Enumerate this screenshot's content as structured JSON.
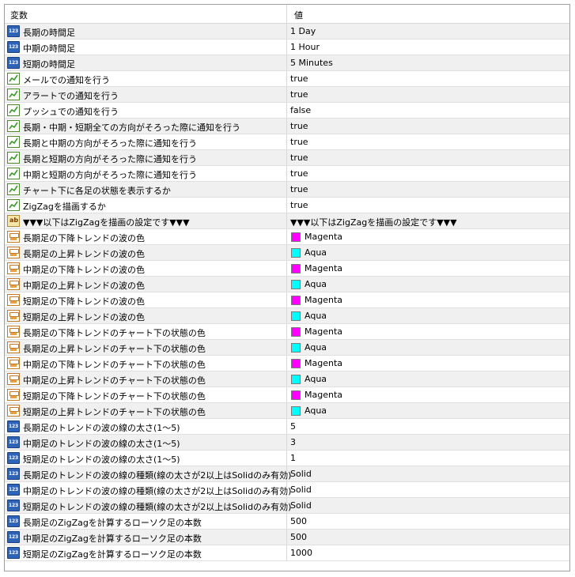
{
  "header": {
    "name_col": "変数",
    "value_col": "値"
  },
  "rows": [
    {
      "icon": "numeric-icon",
      "name": "長期の時間足",
      "value": "1 Day"
    },
    {
      "icon": "numeric-icon",
      "name": "中期の時間足",
      "value": "1 Hour"
    },
    {
      "icon": "numeric-icon",
      "name": "短期の時間足",
      "value": "5 Minutes"
    },
    {
      "icon": "boolean-icon",
      "name": "メールでの通知を行う",
      "value": "true"
    },
    {
      "icon": "boolean-icon",
      "name": "アラートでの通知を行う",
      "value": "true"
    },
    {
      "icon": "boolean-icon",
      "name": "プッシュでの通知を行う",
      "value": "false"
    },
    {
      "icon": "boolean-icon",
      "name": "長期・中期・短期全ての方向がそろった際に通知を行う",
      "value": "true"
    },
    {
      "icon": "boolean-icon",
      "name": "長期と中期の方向がそろった際に通知を行う",
      "value": "true"
    },
    {
      "icon": "boolean-icon",
      "name": "長期と短期の方向がそろった際に通知を行う",
      "value": "true"
    },
    {
      "icon": "boolean-icon",
      "name": "中期と短期の方向がそろった際に通知を行う",
      "value": "true"
    },
    {
      "icon": "boolean-icon",
      "name": "チャート下に各足の状態を表示するか",
      "value": "true"
    },
    {
      "icon": "boolean-icon",
      "name": "ZigZagを描画するか",
      "value": "true"
    },
    {
      "icon": "string-icon",
      "name": "▼▼▼以下はZigZagを描画の設定です▼▼▼",
      "value": "▼▼▼以下はZigZagを描画の設定です▼▼▼"
    },
    {
      "icon": "color-icon",
      "name": "長期足の下降トレンドの波の色",
      "value": "Magenta",
      "color": "#ff00ff"
    },
    {
      "icon": "color-icon",
      "name": "長期足の上昇トレンドの波の色",
      "value": "Aqua",
      "color": "#00ffff"
    },
    {
      "icon": "color-icon",
      "name": "中期足の下降トレンドの波の色",
      "value": "Magenta",
      "color": "#ff00ff"
    },
    {
      "icon": "color-icon",
      "name": "中期足の上昇トレンドの波の色",
      "value": "Aqua",
      "color": "#00ffff"
    },
    {
      "icon": "color-icon",
      "name": "短期足の下降トレンドの波の色",
      "value": "Magenta",
      "color": "#ff00ff"
    },
    {
      "icon": "color-icon",
      "name": "短期足の上昇トレンドの波の色",
      "value": "Aqua",
      "color": "#00ffff"
    },
    {
      "icon": "color-icon",
      "name": "長期足の下降トレンドのチャート下の状態の色",
      "value": "Magenta",
      "color": "#ff00ff"
    },
    {
      "icon": "color-icon",
      "name": "長期足の上昇トレンドのチャート下の状態の色",
      "value": "Aqua",
      "color": "#00ffff"
    },
    {
      "icon": "color-icon",
      "name": "中期足の下降トレンドのチャート下の状態の色",
      "value": "Magenta",
      "color": "#ff00ff"
    },
    {
      "icon": "color-icon",
      "name": "中期足の上昇トレンドのチャート下の状態の色",
      "value": "Aqua",
      "color": "#00ffff"
    },
    {
      "icon": "color-icon",
      "name": "短期足の下降トレンドのチャート下の状態の色",
      "value": "Magenta",
      "color": "#ff00ff"
    },
    {
      "icon": "color-icon",
      "name": "短期足の上昇トレンドのチャート下の状態の色",
      "value": "Aqua",
      "color": "#00ffff"
    },
    {
      "icon": "numeric-icon",
      "name": "長期足のトレンドの波の線の太さ(1〜5)",
      "value": "5"
    },
    {
      "icon": "numeric-icon",
      "name": "中期足のトレンドの波の線の太さ(1〜5)",
      "value": "3"
    },
    {
      "icon": "numeric-icon",
      "name": "短期足のトレンドの波の線の太さ(1〜5)",
      "value": "1"
    },
    {
      "icon": "numeric-icon",
      "name": "長期足のトレンドの波の線の種類(線の太さが2以上はSolidのみ有効)",
      "value": "Solid"
    },
    {
      "icon": "numeric-icon",
      "name": "中期足のトレンドの波の線の種類(線の太さが2以上はSolidのみ有効)",
      "value": "Solid"
    },
    {
      "icon": "numeric-icon",
      "name": "短期足のトレンドの波の線の種類(線の太さが2以上はSolidのみ有効)",
      "value": "Solid"
    },
    {
      "icon": "numeric-icon",
      "name": "長期足のZigZagを計算するローソク足の本数",
      "value": "500"
    },
    {
      "icon": "numeric-icon",
      "name": "中期足のZigZagを計算するローソク足の本数",
      "value": "500"
    },
    {
      "icon": "numeric-icon",
      "name": "短期足のZigZagを計算するローソク足の本数",
      "value": "1000"
    }
  ]
}
